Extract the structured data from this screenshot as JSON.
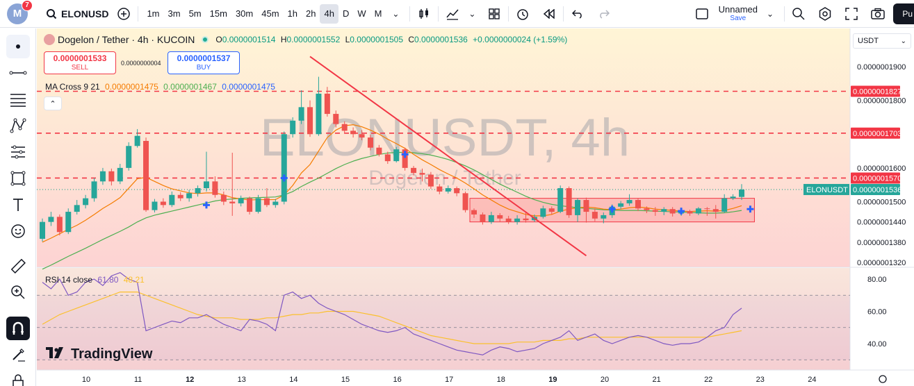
{
  "header": {
    "notifications": "7",
    "avatar_letter": "M",
    "symbol": "ELONUSD",
    "intervals": [
      "1m",
      "3m",
      "5m",
      "15m",
      "30m",
      "45m",
      "1h",
      "2h",
      "4h",
      "D",
      "W",
      "M"
    ],
    "active_interval": "4h",
    "layout_name": "Unnamed",
    "save_label": "Save",
    "publish_label": "Pu"
  },
  "legend": {
    "title": "Dogelon / Tether · 4h · KUCOIN",
    "o_label": "O",
    "o": "0.0000001514",
    "h_label": "H",
    "h": "0.0000001552",
    "l_label": "L",
    "l": "0.0000001505",
    "c_label": "C",
    "c": "0.0000001536",
    "change": "+0.0000000024 (+1.59%)"
  },
  "trade": {
    "sell_price": "0.0000001533",
    "sell_label": "SELL",
    "spread": "0.0000000004",
    "buy_price": "0.0000001537",
    "buy_label": "BUY"
  },
  "indicators": {
    "ma_name": "MA Cross 9 21",
    "ma_v1": "0.0000001475",
    "ma_v2": "0.0000001467",
    "ma_v3": "0.0000001475",
    "rsi_name": "RSI 14 close",
    "rsi_v1": "61.80",
    "rsi_v2": "48.21"
  },
  "currency": "USDT",
  "watermark": {
    "main": "ELONUSDT, 4h",
    "sub": "Dogelon / Tether"
  },
  "brand": "TradingView",
  "colors": {
    "up": "#26a69a",
    "down": "#ef5350",
    "ma_fast": "#f57c00",
    "ma_slow": "#4caf50",
    "rsi": "#7e57c2",
    "rsi_ma": "#fbc02d",
    "dash": "#f23645"
  },
  "chart_data": {
    "type": "candlestick",
    "price_axis": [
      "0.0000001900",
      "0.0000001800",
      "0.0000001600",
      "0.0000001500",
      "0.0000001440",
      "0.0000001380",
      "0.0000001320"
    ],
    "price_labels": [
      {
        "text": "0.0000001827",
        "kind": "line"
      },
      {
        "text": "0.0000001703",
        "kind": "line"
      },
      {
        "text": "0.0000001570",
        "kind": "line"
      },
      {
        "text": "0.0000001536",
        "kind": "last"
      },
      {
        "text": "ELONUSDT",
        "kind": "symbol"
      }
    ],
    "rsi_axis": [
      "80.00",
      "60.00",
      "40.00"
    ],
    "x_ticks": [
      "10",
      "11",
      "12",
      "13",
      "14",
      "15",
      "16",
      "17",
      "18",
      "19",
      "20",
      "21",
      "22",
      "23",
      "24"
    ],
    "bold_ticks": [
      "12",
      "19"
    ],
    "candles": [
      [
        1.39e-07,
        1.44e-07,
        1.382e-07,
        1.45e-07
      ],
      [
        1.44e-07,
        1.455e-07,
        1.428e-07,
        1.47e-07
      ],
      [
        1.455e-07,
        1.41e-07,
        1.4e-07,
        1.462e-07
      ],
      [
        1.41e-07,
        1.47e-07,
        1.404e-07,
        1.48e-07
      ],
      [
        1.47e-07,
        1.49e-07,
        1.462e-07,
        1.505e-07
      ],
      [
        1.49e-07,
        1.51e-07,
        1.48e-07,
        1.52e-07
      ],
      [
        1.51e-07,
        1.56e-07,
        1.5e-07,
        1.57e-07
      ],
      [
        1.56e-07,
        1.59e-07,
        1.55e-07,
        1.6e-07
      ],
      [
        1.59e-07,
        1.56e-07,
        1.548e-07,
        1.598e-07
      ],
      [
        1.56e-07,
        1.6e-07,
        1.552e-07,
        1.612e-07
      ],
      [
        1.6e-07,
        1.665e-07,
        1.592e-07,
        1.676e-07
      ],
      [
        1.665e-07,
        1.695e-07,
        1.66e-07,
        1.715e-07
      ],
      [
        1.68e-07,
        1.475e-07,
        1.47e-07,
        1.69e-07
      ],
      [
        1.475e-07,
        1.5e-07,
        1.468e-07,
        1.508e-07
      ],
      [
        1.5e-07,
        1.49e-07,
        1.482e-07,
        1.51e-07
      ],
      [
        1.49e-07,
        1.52e-07,
        1.484e-07,
        1.53e-07
      ],
      [
        1.52e-07,
        1.51e-07,
        1.502e-07,
        1.528e-07
      ],
      [
        1.51e-07,
        1.525e-07,
        1.5e-07,
        1.535e-07
      ],
      [
        1.525e-07,
        1.54e-07,
        1.515e-07,
        1.548e-07
      ],
      [
        1.54e-07,
        1.56e-07,
        1.53e-07,
        1.648e-07
      ],
      [
        1.56e-07,
        1.52e-07,
        1.512e-07,
        1.575e-07
      ],
      [
        1.52e-07,
        1.5e-07,
        1.49e-07,
        1.53e-07
      ],
      [
        1.5e-07,
        1.495e-07,
        1.458e-07,
        1.645e-07
      ],
      [
        1.495e-07,
        1.51e-07,
        1.486e-07,
        1.518e-07
      ],
      [
        1.51e-07,
        1.47e-07,
        1.462e-07,
        1.515e-07
      ],
      [
        1.47e-07,
        1.51e-07,
        1.465e-07,
        1.52e-07
      ],
      [
        1.51e-07,
        1.49e-07,
        1.484e-07,
        1.54e-07
      ],
      [
        1.49e-07,
        1.5e-07,
        1.482e-07,
        1.508e-07
      ],
      [
        1.5e-07,
        1.7e-07,
        1.492e-07,
        1.708e-07
      ],
      [
        1.7e-07,
        1.74e-07,
        1.69e-07,
        1.75e-07
      ],
      [
        1.74e-07,
        1.78e-07,
        1.73e-07,
        1.83e-07
      ],
      [
        1.78e-07,
        1.7e-07,
        1.692e-07,
        1.8e-07
      ],
      [
        1.7e-07,
        1.82e-07,
        1.695e-07,
        1.87e-07
      ],
      [
        1.82e-07,
        1.76e-07,
        1.752e-07,
        1.84e-07
      ],
      [
        1.76e-07,
        1.73e-07,
        1.72e-07,
        1.77e-07
      ],
      [
        1.73e-07,
        1.71e-07,
        1.702e-07,
        1.738e-07
      ],
      [
        1.71e-07,
        1.7e-07,
        1.69e-07,
        1.72e-07
      ],
      [
        1.7e-07,
        1.69e-07,
        1.682e-07,
        1.712e-07
      ],
      [
        1.69e-07,
        1.66e-07,
        1.652e-07,
        1.698e-07
      ],
      [
        1.66e-07,
        1.64e-07,
        1.634e-07,
        1.668e-07
      ],
      [
        1.64e-07,
        1.62e-07,
        1.612e-07,
        1.648e-07
      ],
      [
        1.62e-07,
        1.655e-07,
        1.616e-07,
        1.662e-07
      ],
      [
        1.655e-07,
        1.6e-07,
        1.592e-07,
        1.66e-07
      ],
      [
        1.6e-07,
        1.585e-07,
        1.578e-07,
        1.606e-07
      ],
      [
        1.585e-07,
        1.58e-07,
        1.56e-07,
        1.598e-07
      ],
      [
        1.58e-07,
        1.545e-07,
        1.538e-07,
        1.588e-07
      ],
      [
        1.545e-07,
        1.53e-07,
        1.522e-07,
        1.552e-07
      ],
      [
        1.53e-07,
        1.54e-07,
        1.524e-07,
        1.548e-07
      ],
      [
        1.54e-07,
        1.525e-07,
        1.516e-07,
        1.545e-07
      ],
      [
        1.525e-07,
        1.475e-07,
        1.468e-07,
        1.53e-07
      ],
      [
        1.475e-07,
        1.462e-07,
        1.452e-07,
        1.48e-07
      ],
      [
        1.462e-07,
        1.44e-07,
        1.432e-07,
        1.468e-07
      ],
      [
        1.44e-07,
        1.46e-07,
        1.434e-07,
        1.47e-07
      ],
      [
        1.46e-07,
        1.45e-07,
        1.44e-07,
        1.466e-07
      ],
      [
        1.45e-07,
        1.44e-07,
        1.434e-07,
        1.458e-07
      ],
      [
        1.44e-07,
        1.45e-07,
        1.432e-07,
        1.46e-07
      ],
      [
        1.45e-07,
        1.445e-07,
        1.438e-07,
        1.47e-07
      ],
      [
        1.445e-07,
        1.455e-07,
        1.44e-07,
        1.462e-07
      ],
      [
        1.455e-07,
        1.48e-07,
        1.45e-07,
        1.488e-07
      ],
      [
        1.48e-07,
        1.47e-07,
        1.462e-07,
        1.486e-07
      ],
      [
        1.47e-07,
        1.54e-07,
        1.466e-07,
        1.548e-07
      ],
      [
        1.54e-07,
        1.46e-07,
        1.452e-07,
        1.545e-07
      ],
      [
        1.46e-07,
        1.505e-07,
        1.44e-07,
        1.51e-07
      ],
      [
        1.505e-07,
        1.47e-07,
        1.438e-07,
        1.512e-07
      ],
      [
        1.47e-07,
        1.45e-07,
        1.442e-07,
        1.48e-07
      ],
      [
        1.45e-07,
        1.46e-07,
        1.436e-07,
        1.468e-07
      ],
      [
        1.46e-07,
        1.485e-07,
        1.452e-07,
        1.492e-07
      ],
      [
        1.485e-07,
        1.495e-07,
        1.478e-07,
        1.502e-07
      ],
      [
        1.495e-07,
        1.505e-07,
        1.488e-07,
        1.522e-07
      ],
      [
        1.505e-07,
        1.48e-07,
        1.472e-07,
        1.51e-07
      ],
      [
        1.48e-07,
        1.475e-07,
        1.466e-07,
        1.486e-07
      ],
      [
        1.475e-07,
        1.47e-07,
        1.458e-07,
        1.484e-07
      ],
      [
        1.47e-07,
        1.478e-07,
        1.46e-07,
        1.484e-07
      ],
      [
        1.478e-07,
        1.465e-07,
        1.456e-07,
        1.484e-07
      ],
      [
        1.465e-07,
        1.472e-07,
        1.458e-07,
        1.478e-07
      ],
      [
        1.472e-07,
        1.465e-07,
        1.458e-07,
        1.476e-07
      ],
      [
        1.465e-07,
        1.48e-07,
        1.46e-07,
        1.484e-07
      ],
      [
        1.48e-07,
        1.478e-07,
        1.458e-07,
        1.484e-07
      ],
      [
        1.478e-07,
        1.47e-07,
        1.45e-07,
        1.49e-07
      ],
      [
        1.47e-07,
        1.51e-07,
        1.466e-07,
        1.522e-07
      ],
      [
        1.51e-07,
        1.515e-07,
        1.505e-07,
        1.522e-07
      ],
      [
        1.514e-07,
        1.536e-07,
        1.505e-07,
        1.552e-07
      ]
    ],
    "ma_fast": [
      1.38e-07,
      1.392e-07,
      1.405e-07,
      1.418e-07,
      1.43e-07,
      1.445e-07,
      1.462e-07,
      1.48e-07,
      1.495e-07,
      1.512e-07,
      1.54e-07,
      1.568e-07,
      1.572e-07,
      1.56e-07,
      1.548e-07,
      1.538e-07,
      1.532e-07,
      1.526e-07,
      1.524e-07,
      1.526e-07,
      1.526e-07,
      1.52e-07,
      1.512e-07,
      1.508e-07,
      1.505e-07,
      1.506e-07,
      1.506e-07,
      1.506e-07,
      1.52e-07,
      1.548e-07,
      1.585e-07,
      1.61e-07,
      1.65e-07,
      1.69e-07,
      1.712e-07,
      1.725e-07,
      1.728e-07,
      1.722e-07,
      1.712e-07,
      1.7e-07,
      1.685e-07,
      1.672e-07,
      1.658e-07,
      1.64e-07,
      1.624e-07,
      1.61e-07,
      1.595e-07,
      1.582e-07,
      1.57e-07,
      1.555e-07,
      1.538e-07,
      1.52e-07,
      1.505e-07,
      1.49e-07,
      1.478e-07,
      1.47e-07,
      1.462e-07,
      1.458e-07,
      1.458e-07,
      1.462e-07,
      1.472e-07,
      1.478e-07,
      1.482e-07,
      1.484e-07,
      1.482e-07,
      1.478e-07,
      1.476e-07,
      1.478e-07,
      1.482e-07,
      1.484e-07,
      1.482e-07,
      1.478e-07,
      1.476e-07,
      1.474e-07,
      1.472e-07,
      1.471e-07,
      1.472e-07,
      1.473e-07,
      1.472e-07,
      1.474e-07,
      1.48e-07,
      1.488e-07
    ],
    "ma_slow": [
      1.3e-07,
      1.312e-07,
      1.325e-07,
      1.338e-07,
      1.35e-07,
      1.362e-07,
      1.375e-07,
      1.388e-07,
      1.4e-07,
      1.412e-07,
      1.425e-07,
      1.44e-07,
      1.452e-07,
      1.46e-07,
      1.466e-07,
      1.472e-07,
      1.478e-07,
      1.484e-07,
      1.49e-07,
      1.496e-07,
      1.502e-07,
      1.506e-07,
      1.508e-07,
      1.51e-07,
      1.511e-07,
      1.512e-07,
      1.513e-07,
      1.514e-07,
      1.52e-07,
      1.53e-07,
      1.545e-07,
      1.558e-07,
      1.57e-07,
      1.584e-07,
      1.598e-07,
      1.61e-07,
      1.62e-07,
      1.628e-07,
      1.634e-07,
      1.64e-07,
      1.644e-07,
      1.646e-07,
      1.646e-07,
      1.645e-07,
      1.642e-07,
      1.638e-07,
      1.632e-07,
      1.625e-07,
      1.616e-07,
      1.606e-07,
      1.594e-07,
      1.58e-07,
      1.566e-07,
      1.552e-07,
      1.54e-07,
      1.528e-07,
      1.516e-07,
      1.506e-07,
      1.498e-07,
      1.492e-07,
      1.488e-07,
      1.485e-07,
      1.482e-07,
      1.48e-07,
      1.478e-07,
      1.476e-07,
      1.475e-07,
      1.474e-07,
      1.474e-07,
      1.474e-07,
      1.473e-07,
      1.472e-07,
      1.471e-07,
      1.47e-07,
      1.469e-07,
      1.468e-07,
      1.467e-07,
      1.466e-07,
      1.466e-07,
      1.467e-07,
      1.47e-07,
      1.474e-07
    ],
    "rsi": [
      78,
      74,
      80,
      70,
      72,
      78,
      80,
      76,
      82,
      84,
      80,
      78,
      48,
      50,
      52,
      54,
      53,
      56,
      56,
      58,
      55,
      52,
      50,
      48,
      55,
      54,
      52,
      48,
      70,
      72,
      68,
      70,
      65,
      62,
      60,
      58,
      55,
      52,
      50,
      48,
      47,
      48,
      50,
      46,
      44,
      42,
      40,
      38,
      36,
      35,
      34,
      33,
      36,
      38,
      37,
      35,
      36,
      37,
      40,
      42,
      44,
      48,
      42,
      44,
      46,
      42,
      40,
      42,
      44,
      45,
      44,
      42,
      40,
      39,
      40,
      40,
      41,
      44,
      48,
      50,
      58,
      62
    ],
    "rsi_ma": [
      52,
      55,
      58,
      60,
      62,
      64,
      66,
      68,
      70,
      72,
      72,
      72,
      70,
      68,
      66,
      64,
      62,
      60,
      58,
      57,
      56,
      56,
      56,
      55,
      55,
      55,
      56,
      56,
      57,
      58,
      58,
      59,
      59,
      60,
      60,
      60,
      60,
      59,
      58,
      57,
      55,
      53,
      51,
      49,
      47,
      45,
      44,
      43,
      42,
      41,
      40,
      40,
      40,
      40,
      40,
      41,
      41,
      41,
      42,
      42,
      42,
      43,
      43,
      44,
      44,
      44,
      44,
      44,
      44,
      44,
      44,
      44,
      44,
      44,
      44,
      44,
      44,
      44,
      45,
      46,
      47,
      48
    ],
    "trendline": [
      [
        1.93e-07,
        31
      ],
      [
        1.34e-07,
        63
      ]
    ],
    "levels": [
      1.827e-07,
      1.703e-07,
      1.57e-07
    ],
    "range_box": {
      "start": 50,
      "end": 82,
      "top": 1.51e-07,
      "bottom": 1.44e-07
    },
    "cross_markers": [
      [
        19,
        1.49e-07
      ],
      [
        28,
        1.57e-07
      ],
      [
        42,
        1.64e-07
      ],
      [
        66,
        1.478e-07
      ],
      [
        74,
        1.472e-07
      ],
      [
        82,
        1.478e-07
      ]
    ]
  }
}
